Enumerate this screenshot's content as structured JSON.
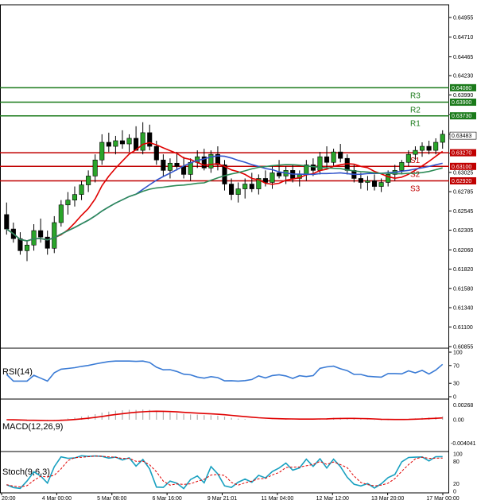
{
  "chart_data": {
    "type": "candlestick",
    "price_axis": {
      "min": 0.60855,
      "max": 0.64955,
      "ticks": [
        "0.64955",
        "0.64710",
        "0.64465",
        "0.64230",
        "0.63990",
        "0.63745",
        "0.63500",
        "0.63265",
        "0.63025",
        "0.62785",
        "0.62545",
        "0.62305",
        "0.62060",
        "0.61820",
        "0.61580",
        "0.61340",
        "0.61100",
        "0.60855"
      ]
    },
    "time_labels": [
      "20:00",
      "4 Mar 00:00",
      "5 Mar 08:00",
      "6 Mar 16:00",
      "9 Mar 21:01",
      "11 Mar 04:00",
      "12 Mar 12:00",
      "13 Mar 20:00",
      "17 Mar 00:00"
    ],
    "resistance": [
      {
        "name": "R3",
        "value": 0.6408,
        "tag": "0.64080",
        "color": "#1a7a1a"
      },
      {
        "name": "R2",
        "value": 0.639,
        "tag": "0.63900",
        "color": "#1a7a1a"
      },
      {
        "name": "R1",
        "value": 0.6373,
        "tag": "0.63730",
        "color": "#1a7a1a"
      }
    ],
    "support": [
      {
        "name": "S1",
        "value": 0.6327,
        "tag": "0.63270",
        "color": "#c00000"
      },
      {
        "name": "S2",
        "value": 0.631,
        "tag": "0.63100",
        "color": "#c00000"
      },
      {
        "name": "S3",
        "value": 0.6292,
        "tag": "0.62920",
        "color": "#c00000"
      }
    ],
    "current_price": {
      "value": 0.63483,
      "tag": "0.63483"
    },
    "candles": [
      [
        0.625,
        0.6265,
        0.6225,
        0.6232
      ],
      [
        0.6232,
        0.624,
        0.6215,
        0.622
      ],
      [
        0.622,
        0.6228,
        0.62,
        0.6205
      ],
      [
        0.6205,
        0.6218,
        0.6192,
        0.6212
      ],
      [
        0.6212,
        0.6238,
        0.6205,
        0.623
      ],
      [
        0.623,
        0.6245,
        0.6215,
        0.6222
      ],
      [
        0.6222,
        0.623,
        0.62,
        0.6208
      ],
      [
        0.6208,
        0.6248,
        0.6202,
        0.624
      ],
      [
        0.624,
        0.6268,
        0.6235,
        0.6262
      ],
      [
        0.6262,
        0.6278,
        0.625,
        0.6268
      ],
      [
        0.6268,
        0.6285,
        0.626,
        0.6275
      ],
      [
        0.6275,
        0.6292,
        0.6268,
        0.6287
      ],
      [
        0.6287,
        0.6305,
        0.6278,
        0.6298
      ],
      [
        0.6298,
        0.6325,
        0.629,
        0.6318
      ],
      [
        0.6318,
        0.635,
        0.6312,
        0.634
      ],
      [
        0.634,
        0.6352,
        0.6328,
        0.6335
      ],
      [
        0.6335,
        0.6348,
        0.6325,
        0.6342
      ],
      [
        0.6342,
        0.6355,
        0.6332,
        0.6338
      ],
      [
        0.6338,
        0.635,
        0.6328,
        0.6345
      ],
      [
        0.6345,
        0.636,
        0.6338,
        0.633
      ],
      [
        0.633,
        0.6365,
        0.6325,
        0.6352
      ],
      [
        0.6352,
        0.6362,
        0.633,
        0.6335
      ],
      [
        0.6335,
        0.6342,
        0.6312,
        0.6318
      ],
      [
        0.6318,
        0.6325,
        0.6298,
        0.6305
      ],
      [
        0.6305,
        0.632,
        0.6295,
        0.6314
      ],
      [
        0.6314,
        0.6328,
        0.6305,
        0.631
      ],
      [
        0.631,
        0.6322,
        0.6295,
        0.63
      ],
      [
        0.63,
        0.632,
        0.6292,
        0.6315
      ],
      [
        0.6315,
        0.633,
        0.6308,
        0.6322
      ],
      [
        0.6322,
        0.6332,
        0.6305,
        0.6308
      ],
      [
        0.6308,
        0.633,
        0.6302,
        0.6325
      ],
      [
        0.6325,
        0.6335,
        0.6305,
        0.6312
      ],
      [
        0.6312,
        0.6318,
        0.628,
        0.6288
      ],
      [
        0.6288,
        0.6295,
        0.6268,
        0.6275
      ],
      [
        0.6275,
        0.629,
        0.6265,
        0.6282
      ],
      [
        0.6282,
        0.6295,
        0.627,
        0.6288
      ],
      [
        0.6288,
        0.6302,
        0.6278,
        0.6282
      ],
      [
        0.6282,
        0.63,
        0.6275,
        0.6295
      ],
      [
        0.6295,
        0.6305,
        0.6285,
        0.629
      ],
      [
        0.629,
        0.631,
        0.6282,
        0.6302
      ],
      [
        0.6302,
        0.6318,
        0.6295,
        0.6298
      ],
      [
        0.6298,
        0.631,
        0.6288,
        0.6305
      ],
      [
        0.6305,
        0.6312,
        0.629,
        0.6295
      ],
      [
        0.6295,
        0.6305,
        0.6285,
        0.63
      ],
      [
        0.63,
        0.6318,
        0.6292,
        0.6312
      ],
      [
        0.6312,
        0.632,
        0.6298,
        0.6305
      ],
      [
        0.6305,
        0.6328,
        0.63,
        0.6322
      ],
      [
        0.6322,
        0.6335,
        0.6308,
        0.6315
      ],
      [
        0.6315,
        0.6332,
        0.631,
        0.6328
      ],
      [
        0.6328,
        0.6338,
        0.6315,
        0.632
      ],
      [
        0.632,
        0.6325,
        0.63,
        0.6305
      ],
      [
        0.6305,
        0.6312,
        0.629,
        0.6295
      ],
      [
        0.6295,
        0.6302,
        0.6282,
        0.629
      ],
      [
        0.629,
        0.6298,
        0.628,
        0.6292
      ],
      [
        0.6292,
        0.63,
        0.628,
        0.6285
      ],
      [
        0.6285,
        0.6295,
        0.6278,
        0.629
      ],
      [
        0.629,
        0.6305,
        0.6285,
        0.63
      ],
      [
        0.63,
        0.6312,
        0.6292,
        0.6305
      ],
      [
        0.6305,
        0.6318,
        0.63,
        0.6315
      ],
      [
        0.6315,
        0.633,
        0.631,
        0.6325
      ],
      [
        0.6325,
        0.6335,
        0.6318,
        0.633
      ],
      [
        0.633,
        0.634,
        0.6322,
        0.6335
      ],
      [
        0.6335,
        0.6342,
        0.6325,
        0.633
      ],
      [
        0.633,
        0.6345,
        0.6325,
        0.634
      ],
      [
        0.634,
        0.6355,
        0.6332,
        0.635
      ]
    ],
    "indicators": {
      "rsi": {
        "label": "RSI(14)",
        "levels": [
          100,
          70,
          30,
          0
        ]
      },
      "macd": {
        "label": "MACD(12,26,9)",
        "levels": [
          "0.00268",
          "0.00",
          "-0.004041"
        ]
      },
      "stoch": {
        "label": "Stoch(9,6,3)",
        "levels": [
          100,
          80,
          20,
          0
        ]
      }
    }
  }
}
